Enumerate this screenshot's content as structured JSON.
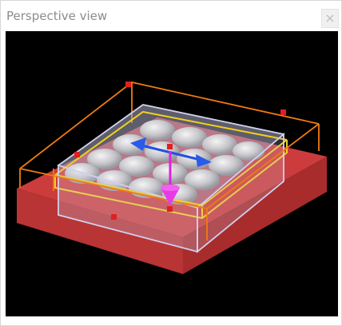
{
  "window": {
    "title": "Perspective view",
    "close_glyph": "×"
  },
  "viewport": {
    "background": "#000000",
    "objects": [
      {
        "name": "red-base-slab",
        "color": "#c83a3a"
      },
      {
        "name": "orange-bounding-box",
        "color": "#f07a10"
      },
      {
        "name": "yellow-selection-frame",
        "color": "#f0d020"
      },
      {
        "name": "transparent-selection-box",
        "color": "#d0d0ee"
      },
      {
        "name": "grey-sphere-array",
        "color": "#c8c8cc"
      }
    ],
    "gizmo": {
      "x_axis_color": "#2050e0",
      "z_axis_color": "#e020e0",
      "handle_color": "#e02020"
    }
  }
}
